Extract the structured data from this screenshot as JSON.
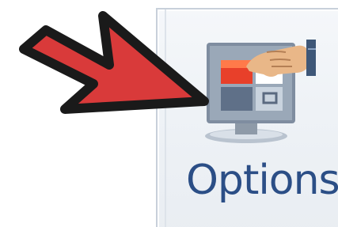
{
  "toolbar": {
    "options_button": {
      "label": "Options",
      "icon": "options-icon"
    }
  },
  "annotation": {
    "arrow_icon": "red-arrow-icon",
    "arrow_color": "#d93a3a",
    "arrow_outline": "#1a1a1a"
  },
  "colors": {
    "label": "#2b4e86",
    "button_border": "#c8d0da"
  }
}
